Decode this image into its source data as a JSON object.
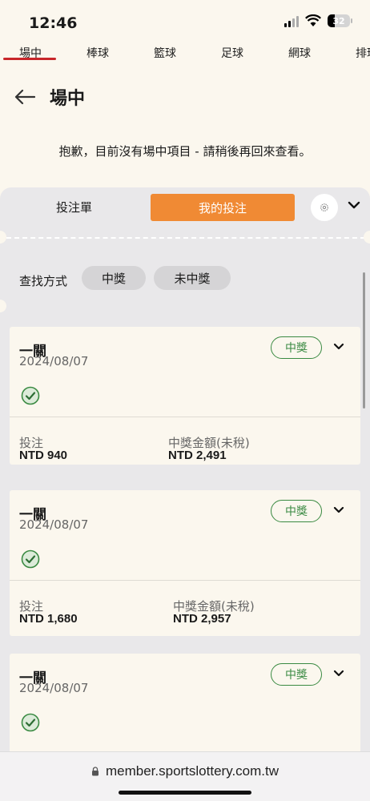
{
  "status_bar": {
    "time": "12:46",
    "battery": "32",
    "battery_level": 0.32
  },
  "sport_tabs": [
    "場中",
    "棒球",
    "籃球",
    "足球",
    "網球",
    "排球"
  ],
  "active_tab": "場中",
  "page": {
    "title": "場中",
    "empty_message": "抱歉，目前沒有場中項目 - 請稍後再回來查看。"
  },
  "betslip": {
    "tab_betslip": "投注單",
    "tab_mybets": "我的投注",
    "filter_label": "查找方式",
    "filters": [
      "中獎",
      "未中獎"
    ]
  },
  "bets": [
    {
      "type": "一關",
      "date": "2024/08/07",
      "status": "中獎",
      "stake_label": "投注",
      "stake": "NTD 940",
      "payout_label": "中獎金額(未稅)",
      "payout": "NTD 2,491"
    },
    {
      "type": "一關",
      "date": "2024/08/07",
      "status": "中獎",
      "stake_label": "投注",
      "stake": "NTD 1,680",
      "payout_label": "中獎金額(未稅)",
      "payout": "NTD 2,957"
    },
    {
      "type": "一關",
      "date": "2024/08/07",
      "status": "中獎"
    }
  ],
  "browser": {
    "url": "member.sportslottery.com.tw"
  },
  "colors": {
    "accent": "#f08a34",
    "win": "#3a8a42",
    "tab_underline": "#c8262a"
  },
  "icons": [
    "signal-icon",
    "wifi-icon",
    "battery-icon",
    "back-arrow-icon",
    "settings-icon",
    "chevron-down-icon",
    "check-circle-icon",
    "lock-icon"
  ]
}
